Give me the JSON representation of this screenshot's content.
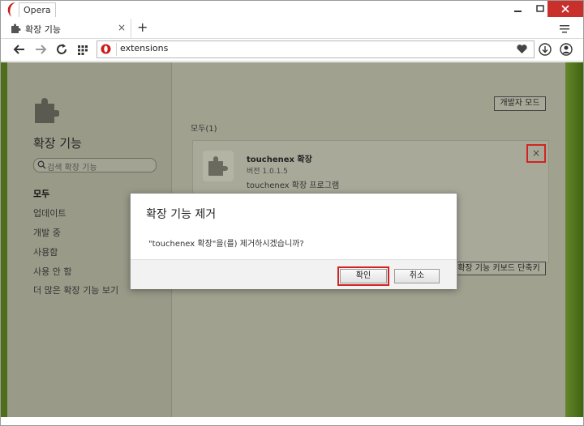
{
  "window": {
    "app_name": "Opera"
  },
  "tabs": [
    {
      "label": "확장 기능",
      "close": "×"
    }
  ],
  "new_tab_label": "+",
  "address_bar": {
    "url": "extensions"
  },
  "sidebar": {
    "title": "확장 기능",
    "search_placeholder": "검색 확장 기능",
    "items": [
      {
        "label": "모두",
        "active": true
      },
      {
        "label": "업데이트"
      },
      {
        "label": "개발 중"
      },
      {
        "label": "사용함"
      },
      {
        "label": "사용 안 함"
      },
      {
        "label": "더 많은 확장 기능 보기"
      }
    ]
  },
  "main": {
    "developer_mode_label": "개발자 모드",
    "section_title": "모두(1)",
    "extension": {
      "name": "touchenex 확장",
      "version": "버전 1.0.1.5",
      "description": "touchenex 확장 프로그램",
      "remove_label": "×"
    },
    "keyboard_shortcuts_label": "확장 기능 키보드 단축키"
  },
  "dialog": {
    "title": "확장 기능 제거",
    "message": "\"touchenex 확장\"을(를) 제거하시겠습니까?",
    "ok_label": "확인",
    "cancel_label": "취소"
  },
  "colors": {
    "opera_red": "#cc1b1b",
    "close_red": "#c9302c",
    "highlight_red": "#d02424"
  }
}
